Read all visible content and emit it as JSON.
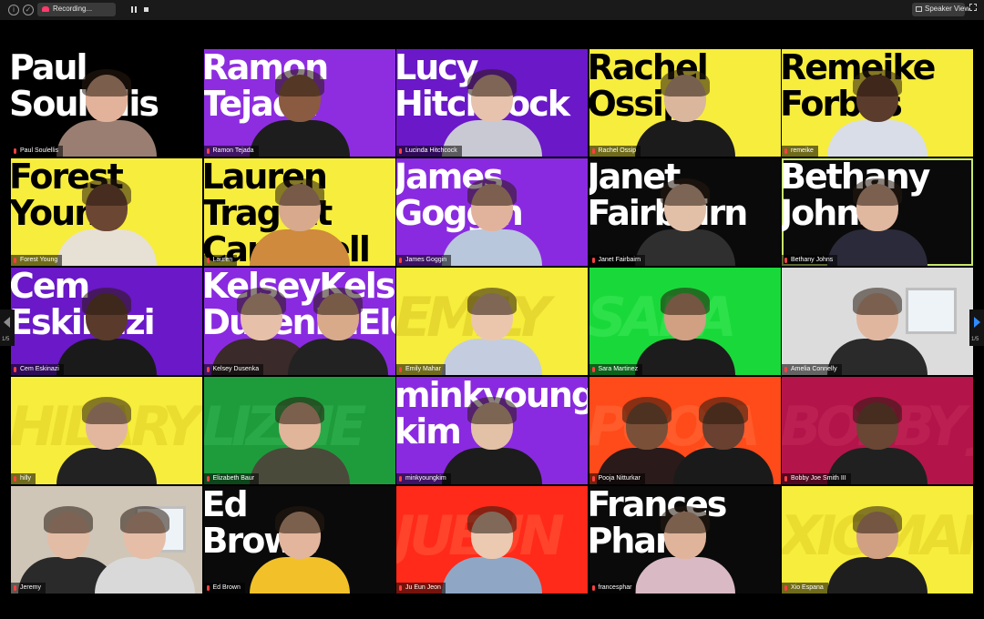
{
  "toolbar": {
    "recording_label": "Recording...",
    "speaker_view_label": "Speaker View",
    "icons": [
      "info-icon",
      "shield-icon",
      "recording-cloud-icon",
      "pause-icon",
      "stop-icon",
      "speaker-view-icon",
      "fullscreen-icon"
    ]
  },
  "pagination": {
    "left": "1/5",
    "right": "1/5"
  },
  "participants": [
    {
      "name": "Paul Soulellis",
      "big_text": "Paul\nSoulellis",
      "bg": "#000000",
      "fg": "#ffffff",
      "style": "block",
      "skin": "#e2b29a",
      "shirt": "#9a7e72"
    },
    {
      "name": "Ramon Tejada",
      "big_text": "Ramon\nTejada",
      "bg": "#8e2de0",
      "fg": "#ffffff",
      "style": "block",
      "skin": "#8a5b41",
      "shirt": "#1d1d1d"
    },
    {
      "name": "Lucinda Hitchcock",
      "big_text": "Lucy\nHitchcock",
      "bg": "#6a18c8",
      "fg": "#ffffff",
      "style": "block",
      "skin": "#e7c2ac",
      "shirt": "#c9c9d4"
    },
    {
      "name": "Rachel Ossip",
      "big_text": "Rachel\nOssip",
      "bg": "#f7ed3c",
      "fg": "#000000",
      "style": "block",
      "skin": "#d9b69c",
      "shirt": "#1b1b1b"
    },
    {
      "name": "remeike",
      "big_text": "Remeike\nForbes",
      "bg": "#f7ed3c",
      "fg": "#000000",
      "style": "block",
      "skin": "#5b3b2b",
      "shirt": "#d8dde8"
    },
    {
      "name": "Forest Young",
      "big_text": "Forest\nYoung",
      "bg": "#f7ed3c",
      "fg": "#000000",
      "style": "block",
      "skin": "#6b4633",
      "shirt": "#e7e0d4"
    },
    {
      "name": "Lauren",
      "big_text": "Lauren\nTragott\nCampbell",
      "bg": "#f7ed3c",
      "fg": "#000000",
      "style": "block",
      "skin": "#d8a98c",
      "shirt": "#cf8a3d"
    },
    {
      "name": "James Goggin",
      "big_text": "James\nGoggin",
      "bg": "#8a2ae0",
      "fg": "#ffffff",
      "style": "block",
      "skin": "#e2b39c",
      "shirt": "#b9c7dc"
    },
    {
      "name": "Janet Fairbairn",
      "big_text": "Janet\nFairbairn",
      "bg": "#0a0a0a",
      "fg": "#ffffff",
      "style": "block",
      "skin": "#e2c0a8",
      "shirt": "#2f2f2f"
    },
    {
      "name": "Bethany Johns",
      "big_text": "Bethany\nJohns",
      "bg": "#0a0a0a",
      "fg": "#ffffff",
      "style": "block",
      "skin": "#e0b79f",
      "shirt": "#2a2a3a",
      "active": true
    },
    {
      "name": "Cem Eskinazi",
      "big_text": "Cem\nEskinazi",
      "bg": "#6a18c8",
      "fg": "#ffffff",
      "style": "block",
      "skin": "#5a3a2a",
      "shirt": "#1a1a1a"
    },
    {
      "name": "Kelsey Dusenka",
      "big_text": "KelseyKelsey\nDusenkaElder",
      "bg": "#8a2ae0",
      "fg": "#ffffff",
      "style": "block",
      "skin": "#e6c0a8",
      "shirt": "#3a2a2a",
      "two": true,
      "skin2": "#d9aa8a",
      "shirt2": "#222222"
    },
    {
      "name": "Emily Mahar",
      "big_text": "EMILY",
      "bg": "#f7ed3c",
      "fg": "#d9c826",
      "style": "italic",
      "skin": "#ecc6ac",
      "shirt": "#c4cde0"
    },
    {
      "name": "Sara Martinez",
      "big_text": "SARA",
      "bg": "#19d93a",
      "fg": "#3fe85a",
      "style": "italic",
      "skin": "#d19f82",
      "shirt": "#1c1c1c"
    },
    {
      "name": "Amelia Connelly",
      "big_text": "",
      "bg": "#dcdcdc",
      "fg": "#ffffff",
      "style": "room",
      "skin": "#e1b69f",
      "shirt": "#2a2a2a"
    },
    {
      "name": "hilly",
      "big_text": "HILARY",
      "bg": "#f7ed3c",
      "fg": "#e0d126",
      "style": "italic",
      "skin": "#e3b79e",
      "shirt": "#222222"
    },
    {
      "name": "Elizabeth Baur",
      "big_text": "LIZZIE",
      "bg": "#1e9c3c",
      "fg": "#34b454",
      "style": "italic",
      "skin": "#e0b59a",
      "shirt": "#4a4a3a"
    },
    {
      "name": "minkyoungkim",
      "big_text": "minkyoung\nkim",
      "bg": "#8a2ae0",
      "fg": "#ffffff",
      "style": "block",
      "skin": "#e3c1a6",
      "shirt": "#1c1c1c"
    },
    {
      "name": "Pooja Nitturkar",
      "big_text": "POOJA",
      "bg": "#ff4a1a",
      "fg": "#ff6a3a",
      "style": "italic",
      "skin": "#7a5038",
      "shirt": "#2a1a1a",
      "two": true,
      "skin2": "#6a4030",
      "shirt2": "#1a1a1a"
    },
    {
      "name": "Bobby Joe Smith III",
      "big_text": "BOBBY JOE",
      "bg": "#b3154a",
      "fg": "#c42a5a",
      "style": "italic",
      "skin": "#6a4634",
      "shirt": "#202020"
    },
    {
      "name": "Jeremy",
      "big_text": "",
      "bg": "#cfc6b8",
      "fg": "#ffffff",
      "style": "room",
      "skin": "#e3bca6",
      "shirt": "#2a2a2a",
      "two": true,
      "skin2": "#e6bea8",
      "shirt2": "#d9d9d9"
    },
    {
      "name": "Ed Brown",
      "big_text": "Ed\nBrown",
      "bg": "#0a0a0a",
      "fg": "#ffffff",
      "style": "block",
      "skin": "#e2b59c",
      "shirt": "#f2c12a"
    },
    {
      "name": "Ju Eun Jeon",
      "big_text": "JUEUN",
      "bg": "#ff2a1a",
      "fg": "#ff5a3a",
      "style": "italic",
      "skin": "#ecc9b1",
      "shirt": "#8fa7c4"
    },
    {
      "name": "francesphar",
      "big_text": "Frances\nPharr",
      "bg": "#0a0a0a",
      "fg": "#ffffff",
      "style": "block",
      "skin": "#e0b49a",
      "shirt": "#d9b9c4"
    },
    {
      "name": "Xio Espana",
      "big_text": "XIOMARA",
      "bg": "#f7ed3c",
      "fg": "#e0d126",
      "style": "italic",
      "skin": "#d1a083",
      "shirt": "#1e1e1e"
    }
  ]
}
